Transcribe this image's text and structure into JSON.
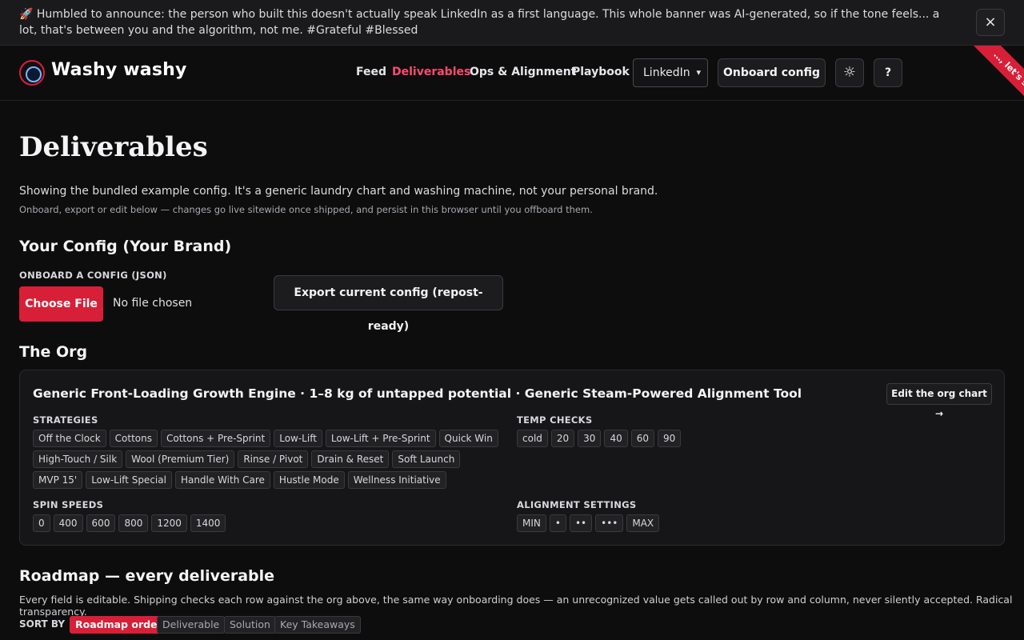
{
  "banner": {
    "text": "🚀 Humbled to announce: the person who built this doesn't actually speak LinkedIn as a first language. This whole banner was AI-generated, so if the tone feels... a lot, that's between you and the algorithm, not me. #Grateful #Blessed",
    "close_label": "×"
  },
  "header": {
    "brand": "Washy washy",
    "nav": [
      "Feed",
      "Deliverables",
      "Ops & Alignment",
      "Playbook"
    ],
    "active_nav": "Deliverables",
    "language_select": "LinkedIn",
    "onboard_button": "Onboard config",
    "theme_icon": "☼",
    "help_button": "?",
    "ribbon": "…, let's sync"
  },
  "page": {
    "title": "Deliverables",
    "intro": "Showing the bundled example config. It's a generic laundry chart and washing machine, not your personal brand.",
    "intro_sub": "Onboard, export or edit below — changes go live sitewide once shipped, and persist in this browser until you offboard them."
  },
  "config": {
    "heading": "Your Config (Your Brand)",
    "onboard_label": "Onboard a config (JSON)",
    "choose_file": "Choose File",
    "no_file": "No file chosen",
    "export_button": "Export current config (repost-ready)"
  },
  "org": {
    "heading": "The Org",
    "title": "Generic Front-Loading Growth Engine · 1–8 kg of untapped potential · Generic Steam-Powered Alignment Tool",
    "edit_button": "Edit the org chart →",
    "strategies_label": "Strategies",
    "strategies": [
      "Off the Clock",
      "Cottons",
      "Cottons + Pre-Sprint",
      "Low-Lift",
      "Low-Lift + Pre-Sprint",
      "Quick Win",
      "High-Touch / Silk",
      "Wool (Premium Tier)",
      "Rinse / Pivot",
      "Drain & Reset",
      "Soft Launch",
      "MVP 15'",
      "Low-Lift Special",
      "Handle With Care",
      "Hustle Mode",
      "Wellness Initiative"
    ],
    "temp_label": "Temp checks",
    "temps": [
      "cold",
      "20",
      "30",
      "40",
      "60",
      "90"
    ],
    "spin_label": "Spin speeds",
    "spins": [
      "0",
      "400",
      "600",
      "800",
      "1200",
      "1400"
    ],
    "alignment_label": "Alignment settings",
    "alignment": [
      "MIN",
      "•",
      "••",
      "•••",
      "MAX"
    ]
  },
  "roadmap": {
    "heading": "Roadmap — every deliverable",
    "sub": "Every field is editable. Shipping checks each row against the org above, the same way onboarding does — an unrecognized value gets called out by row and column, never silently accepted. Radical transparency.",
    "sort_label": "SORT BY",
    "sort_options": [
      "Roadmap order",
      "Deliverable",
      "Solution",
      "Key Takeaways"
    ],
    "active_sort": "Roadmap order"
  }
}
